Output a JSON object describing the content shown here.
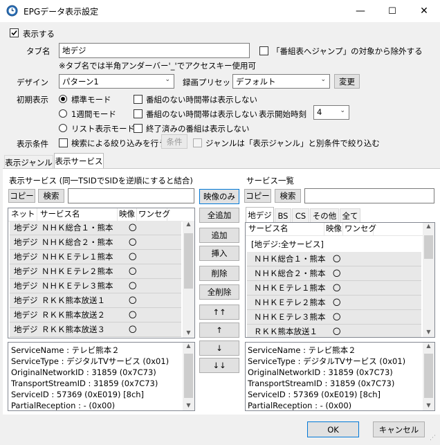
{
  "window": {
    "title": "EPGデータ表示設定",
    "minimize": "—",
    "maximize": "☐",
    "close": "✕"
  },
  "show_check": {
    "label": "表示する",
    "checked": true
  },
  "tabname": {
    "label": "タブ名",
    "value": "地デジ",
    "note": "※タブ名では半角アンダーバー'_'でアクセスキー使用可",
    "exclude_label": "「番組表へジャンプ」の対象から除外する"
  },
  "design": {
    "label": "デザイン",
    "value": "パターン1",
    "preset_label": "録画プリセット",
    "preset_value": "デフォルト",
    "change_btn": "変更"
  },
  "initial": {
    "label": "初期表示",
    "modes": [
      "標準モード",
      "1週間モード",
      "リスト表示モード"
    ],
    "opts": [
      "番組のない時間帯は表示しない",
      "番組のない時間帯は表示しない",
      "終了済みの番組は表示しない"
    ],
    "start_label": "表示開始時刻",
    "start_value": "4"
  },
  "condition": {
    "label": "表示条件",
    "search_label": "検索による絞り込みを行う",
    "cond_btn": "条件",
    "genre_label": "ジャンルは「表示ジャンル」と別条件で絞り込む"
  },
  "tabs": [
    "表示ジャンル",
    "表示サービス"
  ],
  "left": {
    "title": "表示サービス (同一TSIDでSIDを逆順にすると結合)",
    "copy_btn": "コピー",
    "search_btn": "検索",
    "headers": [
      "ネット",
      "サービス名",
      "映像",
      "ワンセグ"
    ],
    "rows": [
      [
        "地デジ",
        "ＮＨＫ総合１・熊本",
        "〇",
        ""
      ],
      [
        "地デジ",
        "ＮＨＫ総合２・熊本",
        "〇",
        ""
      ],
      [
        "地デジ",
        "ＮＨＫＥテレ１熊本",
        "〇",
        ""
      ],
      [
        "地デジ",
        "ＮＨＫＥテレ２熊本",
        "〇",
        ""
      ],
      [
        "地デジ",
        "ＮＨＫＥテレ３熊本",
        "〇",
        ""
      ],
      [
        "地デジ",
        "ＲＫＫ熊本放送１",
        "〇",
        ""
      ],
      [
        "地デジ",
        "ＲＫＫ熊本放送２",
        "〇",
        ""
      ],
      [
        "地デジ",
        "ＲＫＫ熊本放送３",
        "〇",
        ""
      ]
    ],
    "info": [
      "ServiceName : テレビ熊本２",
      "ServiceType : デジタルTVサービス (0x01)",
      "OriginalNetworkID : 31859 (0x7C73)",
      "TransportStreamID : 31859 (0x7C73)",
      "ServiceID : 57369 (0xE019) [8ch]",
      "PartialReception : - (0x00)"
    ]
  },
  "middle": {
    "video_only": "映像のみ",
    "add_all": "全追加",
    "add": "追加",
    "insert": "挿入",
    "delete": "削除",
    "delete_all": "全削除",
    "top": "↑↑",
    "up": "↑",
    "down": "↓",
    "bottom": "↓↓"
  },
  "right": {
    "title": "サービス一覧",
    "copy_btn": "コピー",
    "search_btn": "検索",
    "net_tabs": [
      "地デジ",
      "BS",
      "CS",
      "その他",
      "全て"
    ],
    "headers": [
      "サービス名",
      "映像",
      "ワンセグ"
    ],
    "group": "[地デジ:全サービス]",
    "rows": [
      [
        "ＮＨＫ総合１・熊本",
        "〇",
        ""
      ],
      [
        "ＮＨＫ総合２・熊本",
        "〇",
        ""
      ],
      [
        "ＮＨＫＥテレ１熊本",
        "〇",
        ""
      ],
      [
        "ＮＨＫＥテレ２熊本",
        "〇",
        ""
      ],
      [
        "ＮＨＫＥテレ３熊本",
        "〇",
        ""
      ],
      [
        "ＲＫＫ熊本放送１",
        "〇",
        ""
      ]
    ],
    "info": [
      "ServiceName : テレビ熊本２",
      "ServiceType : デジタルTVサービス (0x01)",
      "OriginalNetworkID : 31859 (0x7C73)",
      "TransportStreamID : 31859 (0x7C73)",
      "ServiceID : 57369 (0xE019) [8ch]",
      "PartialReception : - (0x00)"
    ]
  },
  "footer": {
    "ok": "OK",
    "cancel": "キャンセル"
  }
}
